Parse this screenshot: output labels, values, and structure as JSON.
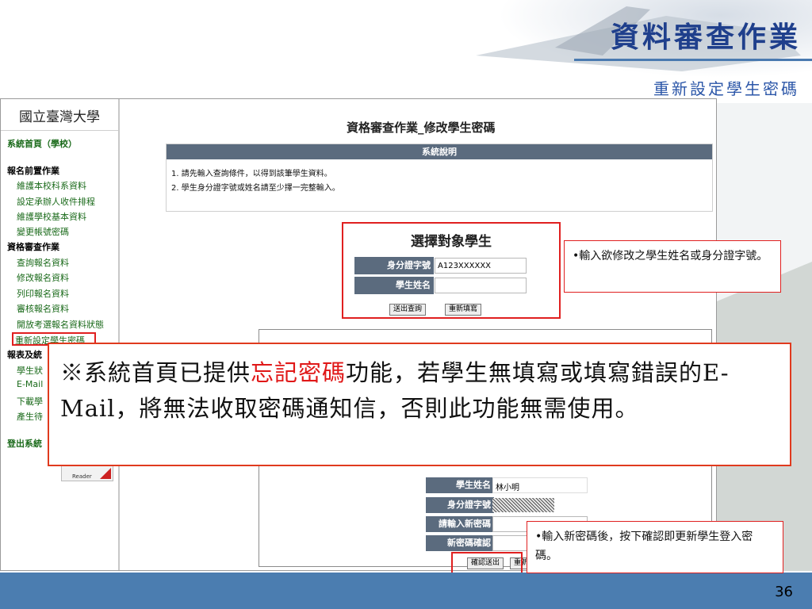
{
  "slide": {
    "title": "資料審查作業",
    "subtitle": "重新設定學生密碼",
    "page_number": "36"
  },
  "sidebar": {
    "school": "國立臺灣大學",
    "home": "系統首頁（學校）",
    "section1": "報名前置作業",
    "s1_items": [
      "維護本校科系資料",
      "設定承辦人收件排程",
      "維護學校基本資料",
      "變更帳號密碼"
    ],
    "section2": "資格審查作業",
    "s2_items": [
      "查詢報名資料",
      "修改報名資料",
      "列印報名資料",
      "審核報名資料",
      "開放考選報名資料狀態",
      "重新設定學生密碼"
    ],
    "section3": "報表及統",
    "s3_items": [
      "學生狀",
      "E-Mail",
      "下載學",
      "產生待"
    ],
    "logout": "登出系統",
    "reader_badge": "Reader"
  },
  "main": {
    "form_title": "資格審查作業_修改學生密碼",
    "info_header": "系統說明",
    "info_lines": [
      "1. 請先輸入查詢條件，以得到該筆學生資料。",
      "2. 學生身分證字號或姓名請至少擇一完整輸入。"
    ],
    "select_title": "選擇對象學生",
    "id_label": "身分證字號",
    "id_value": "A123XXXXXX",
    "name_label": "學生姓名",
    "name_value": "",
    "query_button": "送出查詢",
    "reset_button": "重新填寫",
    "result_name_label": "學生姓名",
    "result_name_value": "林小明",
    "result_id_label": "身分證字號",
    "new_pwd_label": "請輸入新密碼",
    "confirm_pwd_label": "新密碼確認",
    "submit_button": "確認送出",
    "result_reset_button": "重新"
  },
  "callouts": {
    "c1": "•輸入欲修改之學生姓名或身分證字號。",
    "c2": "•輸入新密碼後，按下確認即更新學生登入密碼。"
  },
  "note": {
    "prefix": "※系統首頁已提供",
    "highlight": "忘記密碼",
    "suffix": "功能，若學生無填寫或填寫錯誤的E-Mail，將無法收取密碼通知信，否則此功能無需使用。"
  },
  "colors": {
    "accent_red": "#e02020",
    "title_blue": "#1f3f8c",
    "bar_blue": "#4b7db0",
    "label_slate": "#5b6b7e"
  }
}
